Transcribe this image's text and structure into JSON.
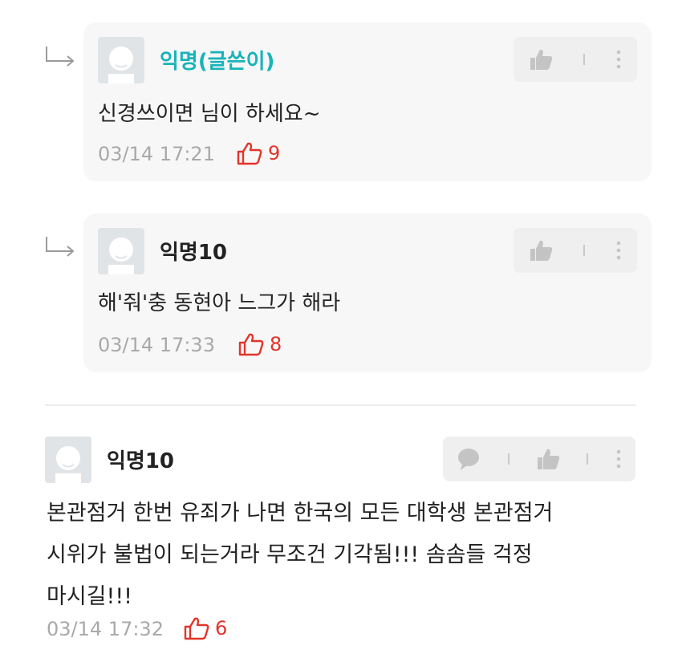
{
  "comments": [
    {
      "is_reply": true,
      "author": "익명(글쓴이)",
      "text": "신경쓰이면 님이 하세요~",
      "time": "03/14 17:21",
      "likes": "9"
    },
    {
      "is_reply": true,
      "author": "익명10",
      "text": "해'줘'충 동현아 느그가 해라",
      "time": "03/14 17:33",
      "likes": "8"
    },
    {
      "is_reply": false,
      "author": "익명10",
      "text_lines": [
        "본관점거 한번 유죄가 나면 한국의 모든 대학생 본관점거",
        "시위가 불법이 되는거라 무조건 기각됨!!! 솜솜들 걱정",
        "마시길!!!"
      ],
      "time": "03/14 17:32",
      "likes": "6"
    }
  ],
  "icons": {
    "reply_arrow": "reply-arrow-icon",
    "avatar": "default-avatar-icon",
    "like_outline": "thumb-up-outline-icon",
    "like_filled": "thumb-up-icon",
    "more": "more-vertical-icon",
    "comment": "speech-bubble-icon"
  },
  "colors": {
    "op_author": "#19b3b9",
    "like_red": "#e2342b",
    "card_bg": "#f7f7f7",
    "meta_gray": "#a9a9a9",
    "action_gray": "#c4c4c4"
  }
}
